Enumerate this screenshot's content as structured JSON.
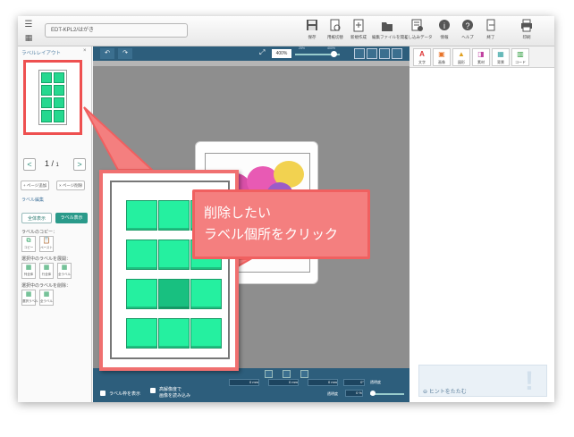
{
  "app": {
    "document_title": "EDT-KPL2/はがき",
    "menu_icon": "menu-icon",
    "grid_icon": "apps-grid-icon"
  },
  "toolbar": {
    "items": [
      {
        "label": "保存",
        "icon": "save-icon"
      },
      {
        "label": "用紙切替",
        "icon": "paper-switch-icon"
      },
      {
        "label": "新規作成",
        "icon": "new-document-icon"
      },
      {
        "label": "編集ファイルを開く",
        "icon": "open-file-icon"
      },
      {
        "label": "差し込みデータ",
        "icon": "merge-data-icon"
      },
      {
        "label": "情報",
        "icon": "info-icon"
      },
      {
        "label": "ヘルプ",
        "icon": "help-icon"
      },
      {
        "label": "終了",
        "icon": "exit-icon"
      },
      {
        "label": "印刷",
        "icon": "print-icon"
      }
    ]
  },
  "left_panel": {
    "title": "ラベルレイアウト",
    "close": "×",
    "page_current": "1",
    "page_total": "1",
    "prev": "<",
    "next": ">",
    "add_page": "+ ページ追加",
    "delete_page": "× ページ削除",
    "label_edit": "ラベル編集",
    "show_all": "全体表示",
    "show_label": "ラベル表示",
    "copy_label": "ラベルのコピー：",
    "copy": "コピー",
    "paste": "ペースト",
    "expand_label": "選択中のラベルを展開：",
    "expand_items": [
      "列全体",
      "行全体",
      "全ラベル"
    ],
    "delete_label": "選択中のラベルを削除：",
    "delete_items": [
      "選択ラベル",
      "全ラベル"
    ]
  },
  "canvas": {
    "zoom": "400%",
    "zoom_min": "25%",
    "zoom_max": "400%",
    "undo": "↶",
    "redo": "↷"
  },
  "bottom_bar": {
    "show_frame": "ラベル枠を表示",
    "hires": "高解像度で",
    "hires2": "画像を読み込み",
    "x_unit": "0 mm",
    "y_unit": "0 mm",
    "w_unit": "0 mm",
    "rotate": "0°",
    "transparency": "透明度",
    "transparency_value": "0 %",
    "opacity_label": "透明度"
  },
  "right_toolbar": {
    "items": [
      {
        "glyph": "A",
        "label": "文字",
        "color": "#d33"
      },
      {
        "glyph": "▣",
        "label": "画像",
        "color": "#e8742a"
      },
      {
        "glyph": "▲",
        "label": "図形",
        "color": "#e0a020"
      },
      {
        "glyph": "◨",
        "label": "素材",
        "color": "#c040a0"
      },
      {
        "glyph": "▦",
        "label": "背景",
        "color": "#30a0a0"
      },
      {
        "glyph": "▥",
        "label": "コード",
        "color": "#2a9a3a"
      }
    ]
  },
  "hint": {
    "close_hint": "ヒントをたたむ"
  },
  "callout": {
    "message": "削除したい\nラベル個所をクリック"
  },
  "colors": {
    "accent": "#2d5e7c",
    "label_green": "#25f0a0",
    "callout_red": "#f47f7f"
  }
}
